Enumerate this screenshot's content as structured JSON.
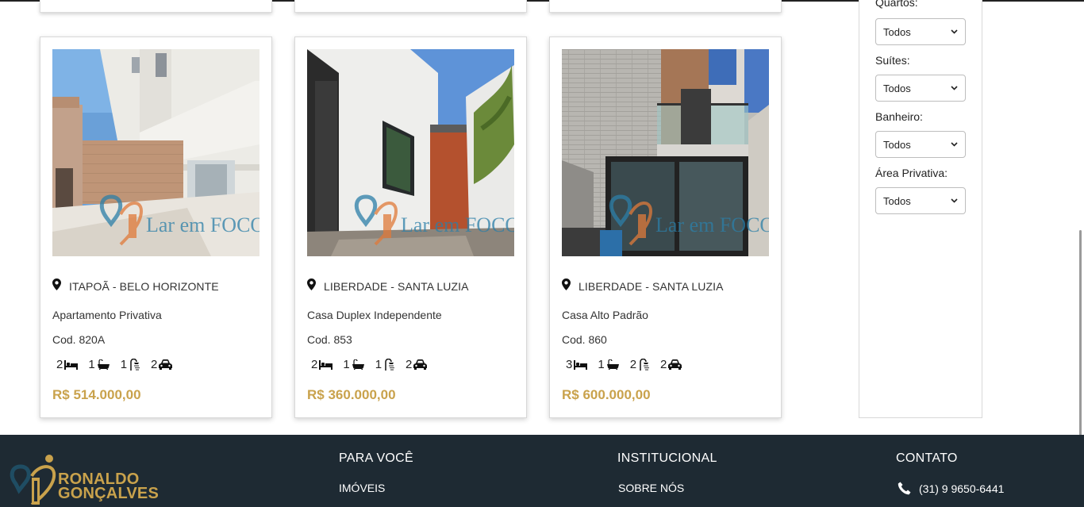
{
  "listings": [
    {
      "location": "ITAPOÃ - BELO HORIZONTE",
      "title": "Apartamento Privativa",
      "code": "Cod. 820A",
      "bedrooms": "2",
      "suites": "1",
      "bathrooms": "1",
      "parking": "2",
      "price": "R$ 514.000,00",
      "watermark": "Lar em FOCO"
    },
    {
      "location": "LIBERDADE - SANTA LUZIA",
      "title": "Casa Duplex Independente",
      "code": "Cod. 853",
      "bedrooms": "2",
      "suites": "1",
      "bathrooms": "1",
      "parking": "2",
      "price": "R$ 360.000,00",
      "watermark": "Lar em FOCO"
    },
    {
      "location": "LIBERDADE - SANTA LUZIA",
      "title": "Casa Alto Padrão",
      "code": "Cod. 860",
      "bedrooms": "3",
      "suites": "1",
      "bathrooms": "2",
      "parking": "2",
      "price": "R$ 600.000,00",
      "watermark": "Lar em FOCO"
    }
  ],
  "filters": {
    "quartos": {
      "label": "Quartos:",
      "value": "Todos"
    },
    "suites": {
      "label": "Suítes:",
      "value": "Todos"
    },
    "banheiro": {
      "label": "Banheiro:",
      "value": "Todos"
    },
    "area": {
      "label": "Área Privativa:",
      "value": "Todos"
    }
  },
  "footer": {
    "logo_line1": "RONALDO",
    "logo_line2": "GONÇALVES",
    "para_voce": {
      "heading": "PARA VOCÊ",
      "link": "IMÓVEIS"
    },
    "institucional": {
      "heading": "INSTITUCIONAL",
      "link": "SOBRE NÓS"
    },
    "contato": {
      "heading": "CONTATO",
      "phone": "(31) 9 9650-6441"
    }
  },
  "colors": {
    "price": "#c9a24c",
    "footer_bg": "#1e2a33",
    "logo_gold": "#c9a24c"
  },
  "icons": [
    "map-pin-icon",
    "bed-icon",
    "bathtub-icon",
    "shower-icon",
    "car-icon",
    "chevron-down-icon",
    "phone-icon"
  ]
}
